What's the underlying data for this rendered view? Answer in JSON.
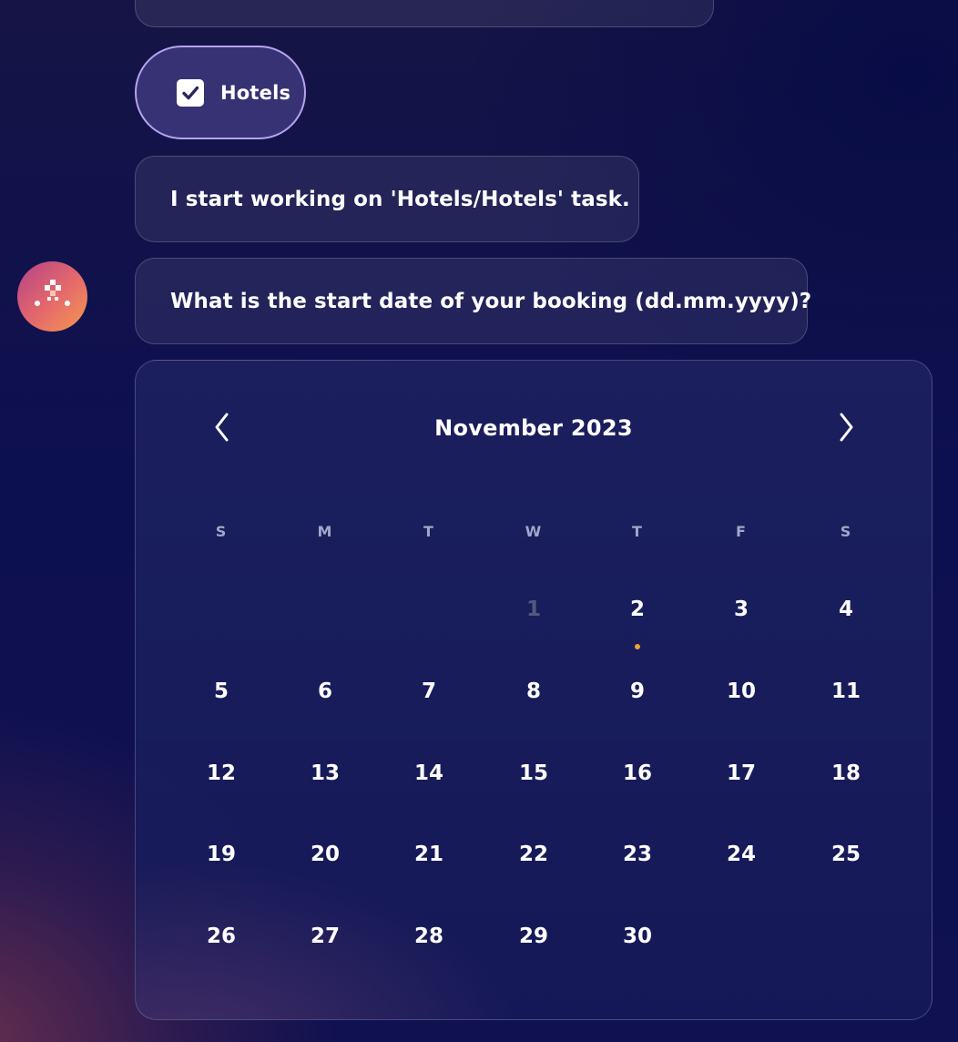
{
  "hotels_chip": {
    "label": "Hotels",
    "checked": true
  },
  "messages": [
    {
      "text": "I start working on 'Hotels/Hotels' task."
    },
    {
      "text": "What is the start date of your booking (dd.mm.yyyy)?"
    }
  ],
  "calendar": {
    "month_label": "November 2023",
    "weekdays": [
      "S",
      "M",
      "T",
      "W",
      "T",
      "F",
      "S"
    ],
    "first_weekday_index": 3,
    "days": [
      "1",
      "2",
      "3",
      "4",
      "5",
      "6",
      "7",
      "8",
      "9",
      "10",
      "11",
      "12",
      "13",
      "14",
      "15",
      "16",
      "17",
      "18",
      "19",
      "20",
      "21",
      "22",
      "23",
      "24",
      "25",
      "26",
      "27",
      "28",
      "29",
      "30"
    ],
    "disabled_days": [
      "1"
    ],
    "today": "2",
    "today_marker_color": "#f0a13a"
  },
  "colors": {
    "chip_border": "#b6a3ee",
    "avatar_gradient": [
      "#b34288",
      "#f29a4f"
    ]
  },
  "icons": {
    "prev": "chevron-left-icon",
    "next": "chevron-right-icon",
    "check": "checkmark-icon",
    "avatar": "assistant-logo-icon"
  }
}
